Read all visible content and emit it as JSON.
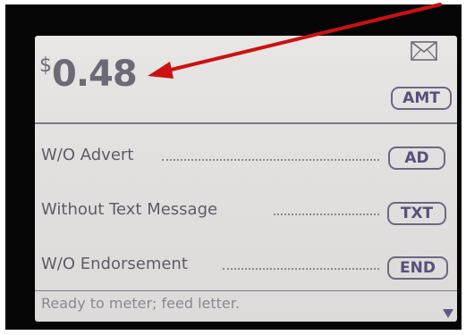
{
  "amount": {
    "currency": "$",
    "value": "0.48"
  },
  "buttons": {
    "amt": "AMT",
    "ad": "AD",
    "txt": "TXT",
    "end": "END"
  },
  "options": [
    {
      "label": "W/O Advert"
    },
    {
      "label": "Without Text Message"
    },
    {
      "label": "W/O Endorsement"
    }
  ],
  "status": {
    "text": "Ready to meter; feed letter."
  },
  "icons": {
    "mail": "envelope-icon",
    "scroll": "scroll-down-icon"
  },
  "colors": {
    "annotation_arrow": "#cc1111",
    "screen_text": "#5f5b68",
    "button_border": "#6f6684"
  }
}
